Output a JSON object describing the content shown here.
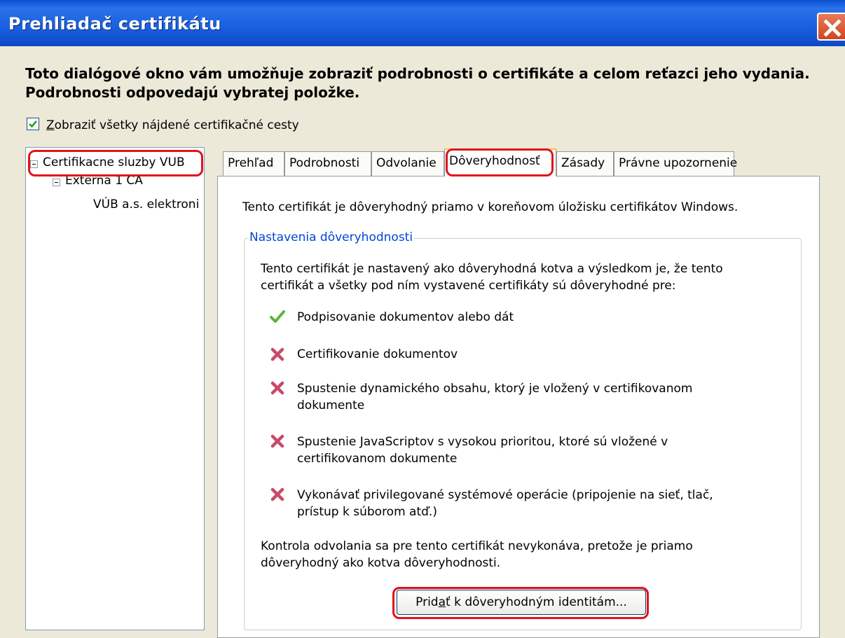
{
  "window": {
    "title": "Prehliadač certifikátu"
  },
  "header": {
    "line1": "Toto dialógové okno vám umožňuje zobraziť podrobnosti o certifikáte a celom reťazci jeho vydania.",
    "line2": "Podrobnosti odpovedajú vybratej položke."
  },
  "show_all_paths": {
    "checked": true,
    "first_letter": "Z",
    "rest": "obraziť všetky nájdené certifikačné cesty"
  },
  "tree": {
    "root": "Certifikacne sluzby VUB",
    "child": "Externa 1 CA",
    "leaf": "VÚB a.s. elektroni"
  },
  "tabs": [
    "Prehľad",
    "Podrobnosti",
    "Odvolanie",
    "Dôveryhodnosť",
    "Zásady",
    "Právne upozornenie"
  ],
  "active_tab": "Dôveryhodnosť",
  "trust": {
    "summary": "Tento certifikát je dôveryhodný priamo v koreňovom úložisku certifikátov Windows.",
    "group_title": "Nastavenia dôveryhodnosti",
    "intro_l1": "Tento certifikát je nastavený ako dôveryhodná kotva a výsledkom je, že tento",
    "intro_l2": "certifikát a všetky pod ním vystavené certifikáty sú dôveryhodné pre:",
    "items": [
      {
        "icon": "check-icon",
        "l1": "Podpisovanie dokumentov alebo dát",
        "l2": ""
      },
      {
        "icon": "cross-icon",
        "l1": "Certifikovanie dokumentov",
        "l2": ""
      },
      {
        "icon": "cross-icon",
        "l1": "Spustenie dynamického obsahu, ktorý je vložený v certifikovanom",
        "l2": "dokumente"
      },
      {
        "icon": "cross-icon",
        "l1": "Spustenie JavaScriptov s vysokou prioritou, ktoré sú vložené v",
        "l2": "certifikovanom dokumente"
      },
      {
        "icon": "cross-icon",
        "l1": "Vykonávať privilegované systémové operácie (pripojenie na sieť, tlač,",
        "l2": "prístup k súborom atď.)"
      }
    ],
    "revocation_l1": "Kontrola odvolania sa pre tento certifikát nevykonáva, pretože je priamo",
    "revocation_l2": "dôveryhodný ako kotva dôveryhodnosti.",
    "button_pre": "Prid",
    "button_accel": "a",
    "button_post": "ť k dôveryhodným identitám..."
  },
  "colors": {
    "highlight": "#e0131a",
    "check": "#5bb536",
    "cross": "#c84b6a",
    "group_label": "#0046d5"
  }
}
